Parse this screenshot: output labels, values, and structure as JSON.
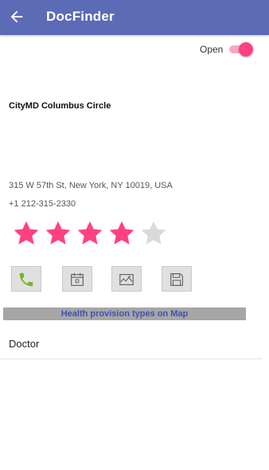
{
  "appbar": {
    "title": "DocFinder",
    "back_icon": "arrow-left-icon",
    "background_color": "#5c6bb5"
  },
  "status": {
    "open_label": "Open",
    "open_toggle_on": true,
    "toggle_color": "#ff4081"
  },
  "place": {
    "name": "CityMD Columbus Circle",
    "address": "315 W 57th St, New York, NY 10019, USA",
    "phone": "+1 212-315-2330"
  },
  "rating": {
    "value": 4,
    "max": 5,
    "filled_color": "#ff4081",
    "empty_color": "#d9d9d9"
  },
  "actions": [
    {
      "icon": "phone-icon",
      "name": "call-button"
    },
    {
      "icon": "calendar-icon",
      "name": "calendar-button"
    },
    {
      "icon": "map-icon",
      "name": "map-button"
    },
    {
      "icon": "save-icon",
      "name": "save-button"
    }
  ],
  "map_button_label": "Health provision types on Map",
  "provision_type": "Doctor"
}
